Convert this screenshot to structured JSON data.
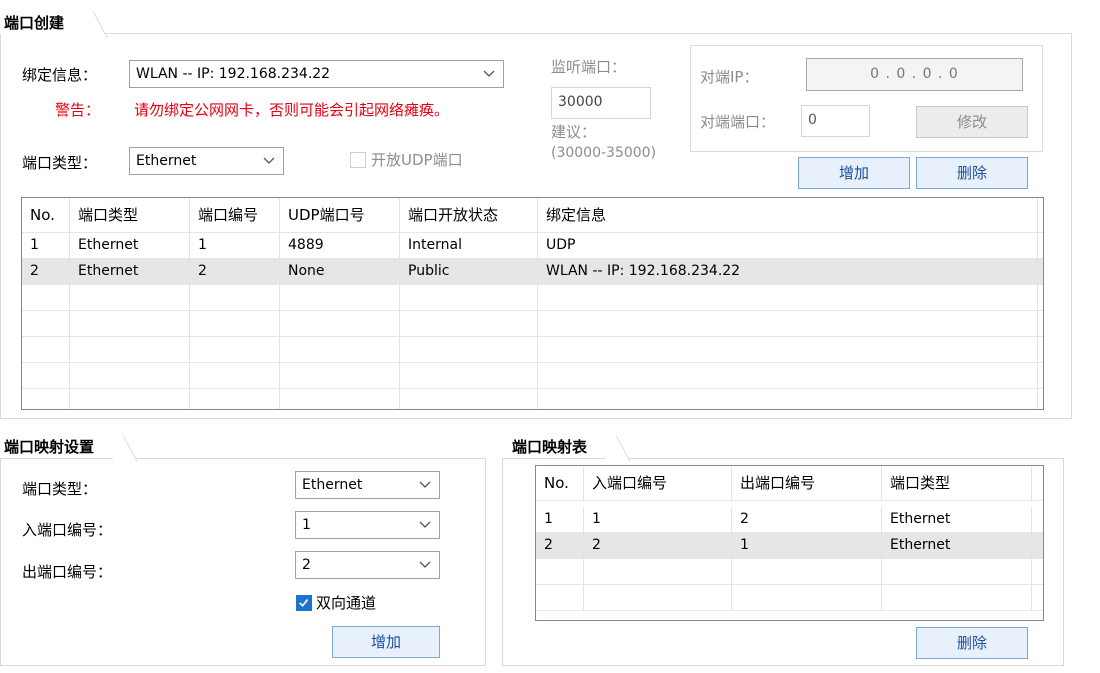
{
  "port_create": {
    "tab": "端口创建",
    "bind_label": "绑定信息：",
    "bind_value": "WLAN -- IP: 192.168.234.22",
    "warning_label": "警告：",
    "warning_text": "请勿绑定公网网卡，否则可能会引起网络瘫痪。",
    "port_type_label": "端口类型：",
    "port_type_value": "Ethernet",
    "listen_port_label": "监听端口：",
    "listen_port_value": "30000",
    "suggest_label": "建议：",
    "suggest_range": "(30000-35000)",
    "open_udp_label": "开放UDP端口",
    "peer_ip_label": "对端IP：",
    "peer_ip_value": "0  .  0  .  0  .  0",
    "peer_port_label": "对端端口：",
    "peer_port_value": "0",
    "modify_button": "修改",
    "add_button": "增加",
    "delete_button": "删除"
  },
  "port_table": {
    "headers": [
      "No.",
      "端口类型",
      "端口编号",
      "UDP端口号",
      "端口开放状态",
      "绑定信息"
    ],
    "rows": [
      [
        "1",
        "Ethernet",
        "1",
        "4889",
        "Internal",
        "UDP"
      ],
      [
        "2",
        "Ethernet",
        "2",
        "None",
        "Public",
        "WLAN -- IP: 192.168.234.22"
      ]
    ]
  },
  "mapping_settings": {
    "tab": "端口映射设置",
    "port_type_label": "端口类型：",
    "port_type_value": "Ethernet",
    "in_port_label": "入端口编号：",
    "in_port_value": "1",
    "out_port_label": "出端口编号：",
    "out_port_value": "2",
    "bidirectional_label": "双向通道",
    "bidirectional_checked": true,
    "add_button": "增加"
  },
  "mapping_table": {
    "tab": "端口映射表",
    "headers": [
      "No.",
      "入端口编号",
      "出端口编号",
      "端口类型"
    ],
    "rows": [
      [
        "1",
        "1",
        "2",
        "Ethernet"
      ],
      [
        "2",
        "2",
        "1",
        "Ethernet"
      ]
    ],
    "delete_button": "删除"
  }
}
